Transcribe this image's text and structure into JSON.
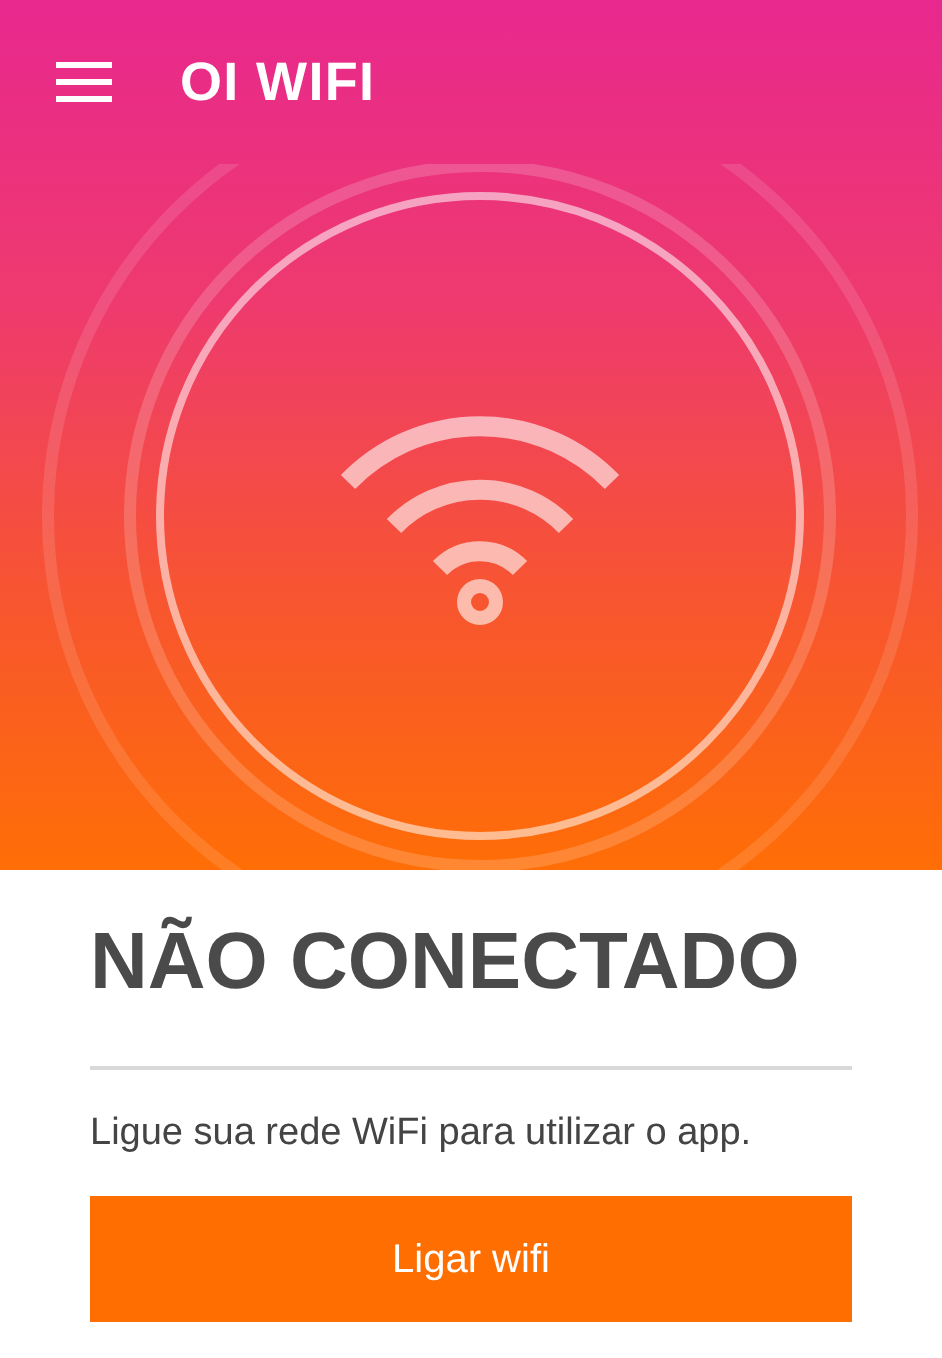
{
  "app_bar": {
    "title": "OI WIFI"
  },
  "status": {
    "title": "NÃO CONECTADO",
    "message": "Ligue sua rede WiFi para utilizar o app."
  },
  "action_button": {
    "label": "Ligar wifi"
  }
}
